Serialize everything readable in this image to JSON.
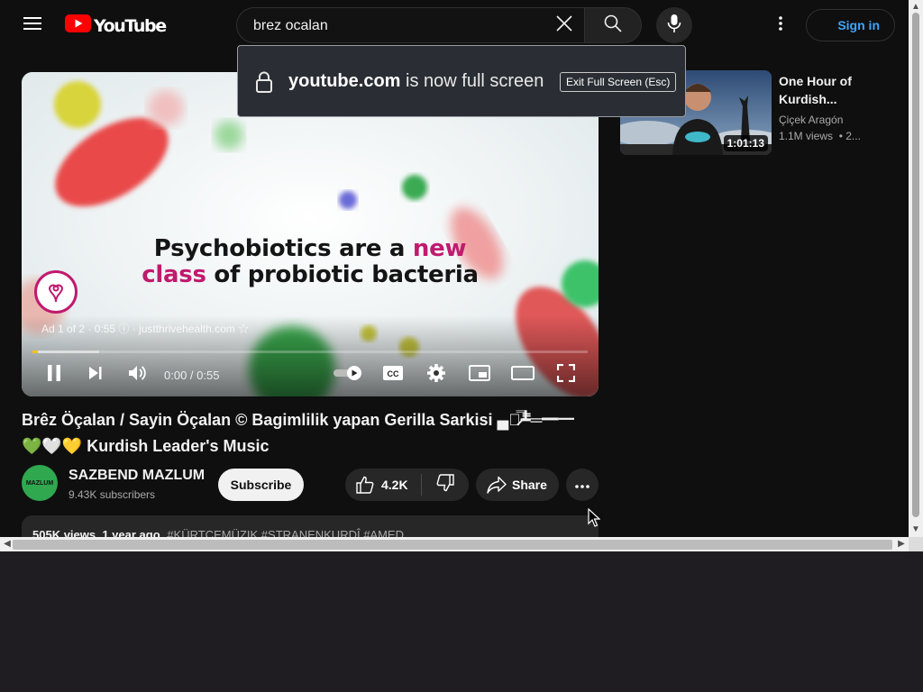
{
  "header": {
    "logo_text": "YouTube",
    "search": {
      "value": "brez ocalan"
    },
    "signin_label": "Sign in"
  },
  "fullscreen_banner": {
    "domain": "youtube.com",
    "message": "is now full screen",
    "exit_label": "Exit Full Screen (Esc)"
  },
  "player": {
    "overlay_caption": {
      "line1_dark": "Psychobiotics are a ",
      "line1_pink": "new",
      "line2_pink": "class",
      "line2_dark": " of probiotic bacteria"
    },
    "ad_info": "Ad 1 of 2 · 0:55 ⓘ · justthrivehealth.com ☆",
    "time": "0:00 / 0:55",
    "progress_fraction": 0.01,
    "buffer_fraction": 0.12,
    "cc_label": "CC"
  },
  "video": {
    "title": "Brêz Öçalan / Sayin Öçalan © Bagimlilik yapan Gerilla Sarkisi ▄︻̷̿┻̿═━一 💚🤍💛 Kurdish Leader's Music",
    "channel": {
      "name": "SAZBEND MAZLUM",
      "subscribers": "9.43K subscribers",
      "avatar_text": "MAZLUM"
    },
    "subscribe_label": "Subscribe",
    "like_count": "4.2K",
    "share_label": "Share",
    "description": {
      "views": "505K views",
      "age": "1 year ago",
      "tags": "#KÜRTCEMÜZIK #STRANENKURDÎ #AMED"
    }
  },
  "recommendations": [
    {
      "title": "One Hour of Kurdish...",
      "channel": "Çiçek Aragón",
      "views": "1.1M views",
      "age": "• 2...",
      "duration": "1:01:13"
    }
  ],
  "colors": {
    "accent_red": "#ff0000",
    "link_blue": "#3ea6ff",
    "progress_yellow": "#f5c518",
    "brand_pink": "#c01a6e"
  }
}
